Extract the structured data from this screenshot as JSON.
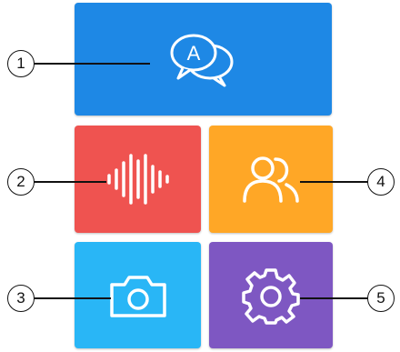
{
  "tiles": [
    {
      "id": "chat",
      "icon": "chat-bubbles-icon",
      "color": "#1e88e5"
    },
    {
      "id": "voice",
      "icon": "sound-wave-icon",
      "color": "#ef5350"
    },
    {
      "id": "contacts",
      "icon": "people-icon",
      "color": "#ffa726"
    },
    {
      "id": "camera",
      "icon": "camera-icon",
      "color": "#29b6f6"
    },
    {
      "id": "settings",
      "icon": "gear-icon",
      "color": "#7e57c2"
    }
  ],
  "chat_icon_letter": "A",
  "callouts": [
    "1",
    "2",
    "3",
    "4",
    "5"
  ]
}
